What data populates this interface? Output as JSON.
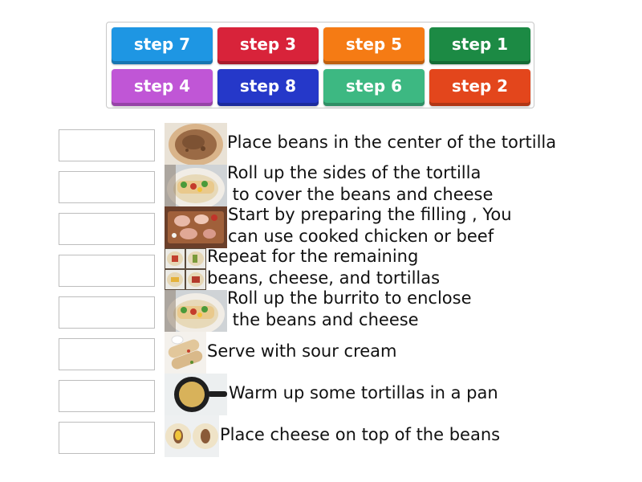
{
  "tiles": [
    {
      "label": "step 7",
      "color": "#1e96e3"
    },
    {
      "label": "step 3",
      "color": "#d8233a"
    },
    {
      "label": "step 5",
      "color": "#f57b14"
    },
    {
      "label": "step 1",
      "color": "#1c8a44"
    },
    {
      "label": "step 4",
      "color": "#c056d6"
    },
    {
      "label": "step 8",
      "color": "#2538c9"
    },
    {
      "label": "step 6",
      "color": "#3db882"
    },
    {
      "label": "step 2",
      "color": "#e3461c"
    }
  ],
  "rows": [
    {
      "image": "beans-on-tortilla-photo",
      "line1": "Place beans in the center of the tortilla",
      "line2": ""
    },
    {
      "image": "rolled-tortilla-photo",
      "line1": "Roll up the sides of the tortilla",
      "line2": " to cover the beans and cheese"
    },
    {
      "image": "raw-chicken-photo",
      "line1": "Start by preparing the filling , You",
      "line2": "can use cooked chicken or beef"
    },
    {
      "image": "tortilla-steps-grid-photo",
      "line1": "Repeat for the remaining",
      "line2": "beans, cheese, and tortillas"
    },
    {
      "image": "rolled-burrito-photo",
      "line1": "Roll up the burrito to enclose",
      "line2": " the beans and cheese"
    },
    {
      "image": "burritos-with-sour-cream-photo",
      "line1": "Serve with sour cream",
      "line2": ""
    },
    {
      "image": "tortilla-in-pan-photo",
      "line1": "Warm up some tortillas in a pan",
      "line2": ""
    },
    {
      "image": "cheese-on-beans-photo",
      "line1": "Place cheese on top of the beans",
      "line2": ""
    }
  ]
}
